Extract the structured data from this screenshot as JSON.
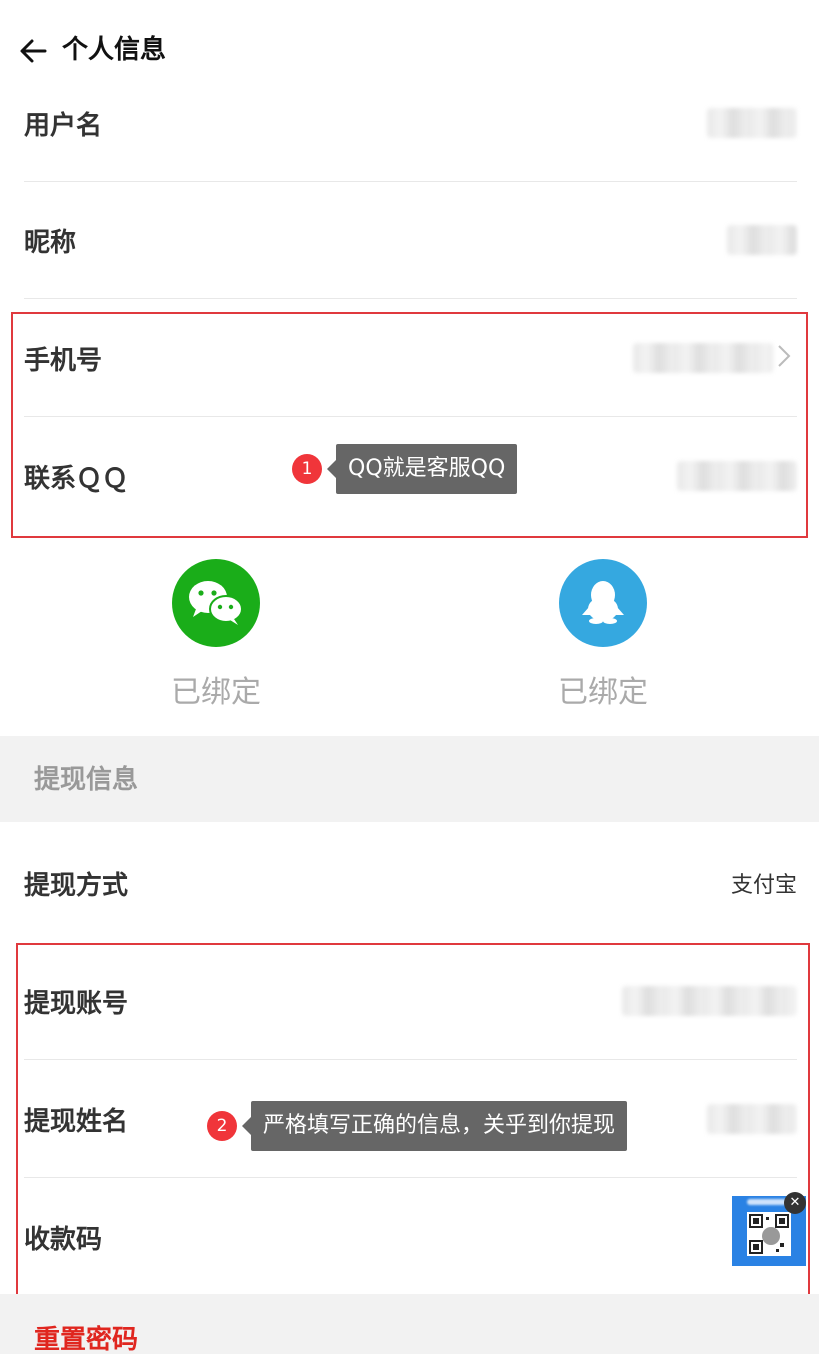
{
  "header": {
    "title": "个人信息"
  },
  "profile": {
    "username_label": "用户名",
    "nickname_label": "昵称",
    "phone_label": "手机号",
    "qq_label": "联系ＱＱ"
  },
  "annotations": {
    "step1_number": "1",
    "step1_text": "QQ就是客服QQ",
    "step2_number": "2",
    "step2_text": "严格填写正确的信息，关乎到你提现"
  },
  "bindings": {
    "wechat": {
      "status": "已绑定",
      "icon": "wechat-icon",
      "color": "#1aad19"
    },
    "qq": {
      "status": "已绑定",
      "icon": "qq-penguin-icon",
      "color": "#35a8e0"
    }
  },
  "withdraw": {
    "section_title": "提现信息",
    "method_label": "提现方式",
    "method_value": "支付宝",
    "account_label": "提现账号",
    "name_label": "提现姓名",
    "qr_label": "收款码",
    "qr_close": "✕"
  },
  "reset_password": "重置密码",
  "colors": {
    "highlight": "#e0393e",
    "accent_red": "#e0261f",
    "tooltip_bg": "#666666"
  }
}
